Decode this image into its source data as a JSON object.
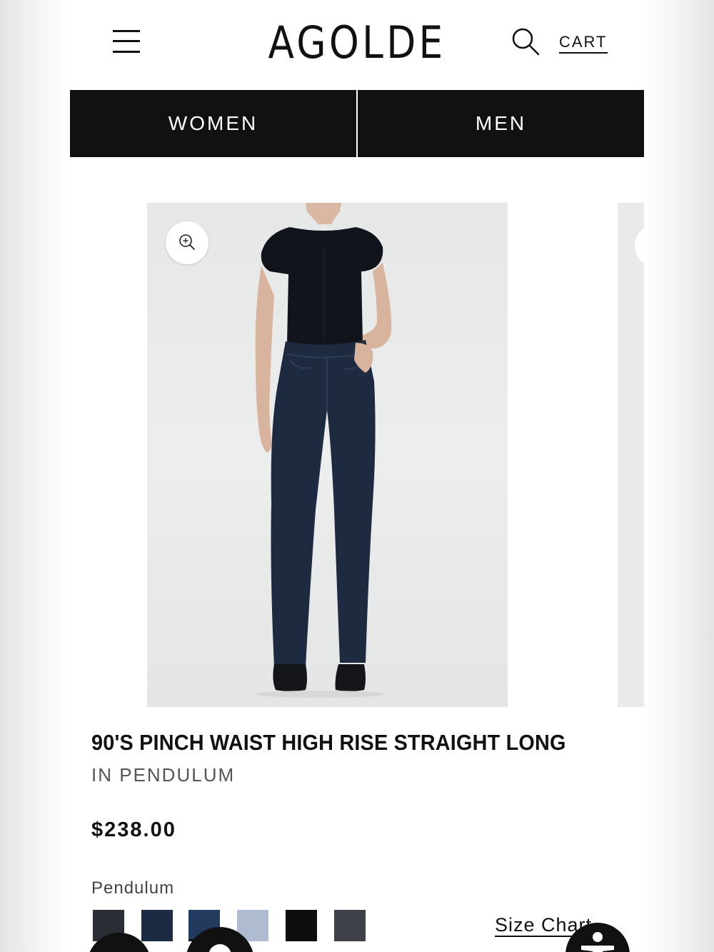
{
  "header": {
    "brand": "AGOLDE",
    "cart_label": "CART",
    "icons": {
      "menu": "hamburger-menu-icon",
      "search": "search-icon"
    }
  },
  "nav": {
    "tabs": [
      {
        "label": "WOMEN"
      },
      {
        "label": "MEN"
      }
    ]
  },
  "gallery": {
    "zoom_icon": "zoom-in-icon",
    "colors": {
      "background": "#e8eaea",
      "denim": "#1e2a3f",
      "top": "#12141c"
    }
  },
  "product": {
    "title": "90'S PINCH WAIST HIGH RISE STRAIGHT LONG",
    "subtitle": "IN PENDULUM",
    "price": "$238.00",
    "selected_color": "Pendulum",
    "swatches": [
      {
        "color": "#2a2d33"
      },
      {
        "color": "#1d2a44"
      },
      {
        "color": "#223a5e"
      },
      {
        "color": "#aebbd0"
      },
      {
        "color": "#0e0e0e"
      },
      {
        "color": "#3e4147"
      }
    ],
    "size_chart_label": "Size Chart"
  },
  "floating": {
    "accessibility_icon": "accessibility-icon"
  }
}
